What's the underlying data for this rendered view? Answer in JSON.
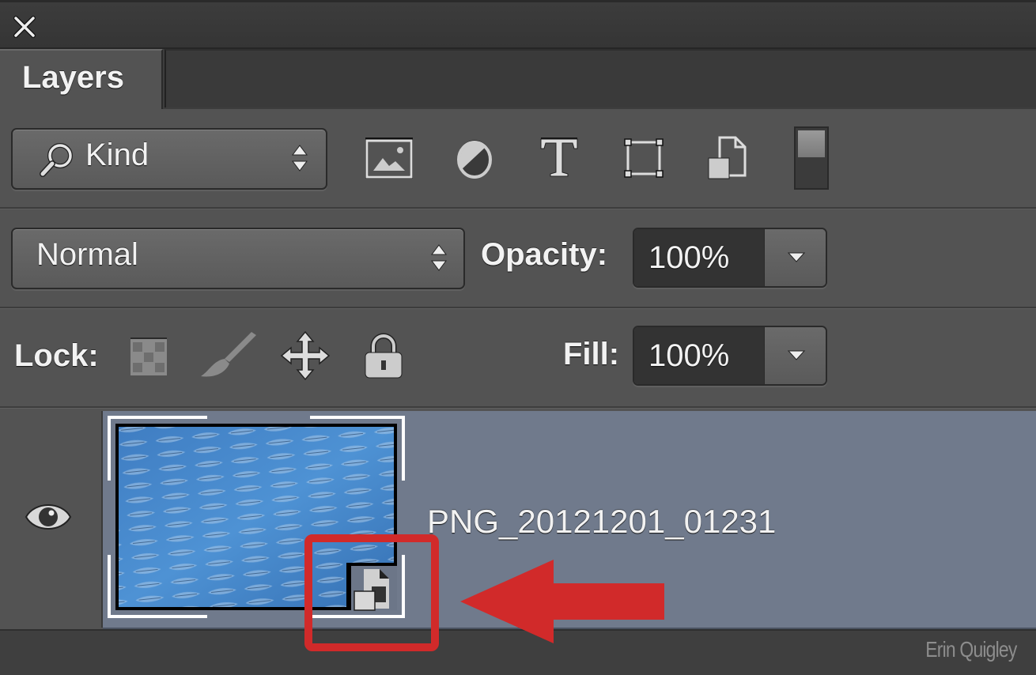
{
  "panel": {
    "close_icon": "close-icon",
    "tab_title": "Layers"
  },
  "filter": {
    "select_label": "Kind",
    "search_icon": "search-icon",
    "filter_icons": [
      "pixel-layer-filter-icon",
      "adjustment-layer-filter-icon",
      "type-layer-filter-icon",
      "shape-layer-filter-icon",
      "smart-object-filter-icon"
    ],
    "toggle": "filter-toggle-switch"
  },
  "blend": {
    "mode": "Normal",
    "opacity_label": "Opacity:",
    "opacity_value": "100%"
  },
  "lock": {
    "label": "Lock:",
    "icons": [
      "lock-transparent-pixels-icon",
      "lock-image-pixels-icon",
      "lock-position-icon",
      "lock-all-icon"
    ],
    "fill_label": "Fill:",
    "fill_value": "100%"
  },
  "layers": [
    {
      "name": "PNG_20121201_01231",
      "visible": true,
      "type": "smart-object",
      "selected": true
    }
  ],
  "annotation": {
    "highlight_color": "#d12a2a",
    "target": "smart-object-badge-icon"
  },
  "watermark": "Erin Quigley",
  "colors": {
    "panel_bg": "#535353",
    "selected_layer_bg": "#707a8c"
  }
}
